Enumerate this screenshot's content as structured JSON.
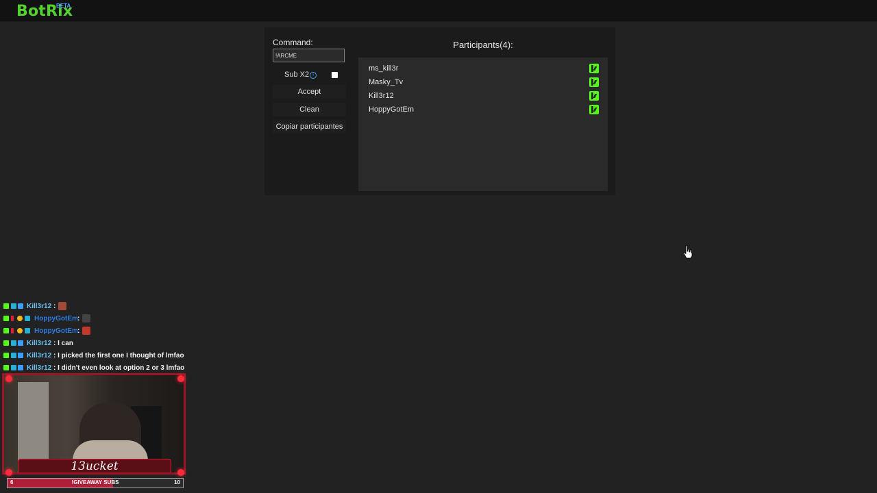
{
  "header": {
    "logo_text": "BotRix",
    "beta_label": "BETA",
    "brand_color": "#54d22e"
  },
  "giveaway": {
    "command_label": "Command:",
    "command_value": "!ARCME",
    "sub_label": "Sub X2",
    "sub_info_icon": "info-icon",
    "sub_checked": false,
    "accept_label": "Accept",
    "clean_label": "Clean",
    "copy_label": "Copiar participantes",
    "participants_title": "Participants(4):",
    "participants": [
      {
        "name": "ms_kill3r",
        "platform_icon": "kick-icon"
      },
      {
        "name": "Masky_Tv",
        "platform_icon": "kick-icon"
      },
      {
        "name": "Kill3r12",
        "platform_icon": "kick-icon"
      },
      {
        "name": "HoppyGotEm",
        "platform_icon": "kick-icon"
      }
    ]
  },
  "chat": {
    "messages": [
      {
        "user": "Kill3r12",
        "text": ":",
        "emote": "emote-icon"
      },
      {
        "user": "HoppyGotEm",
        "text": ":",
        "emote": "eyes-emote-icon"
      },
      {
        "user": "HoppyGotEm",
        "text": ":",
        "emote": "emote-icon"
      },
      {
        "user": "Kill3r12",
        "text": ": I can"
      },
      {
        "user": "Kill3r12",
        "text": ": I picked the first one I thought of lmfao"
      },
      {
        "user": "Kill3r12",
        "text": ": I didn't even look at option 2 or 3 lmfao"
      }
    ]
  },
  "webcam": {
    "streamer_name": "13ucket"
  },
  "sub_goal": {
    "current": "6",
    "title": "!GIVEAWAY SUBS",
    "target": "10",
    "progress_fraction": 0.6
  }
}
